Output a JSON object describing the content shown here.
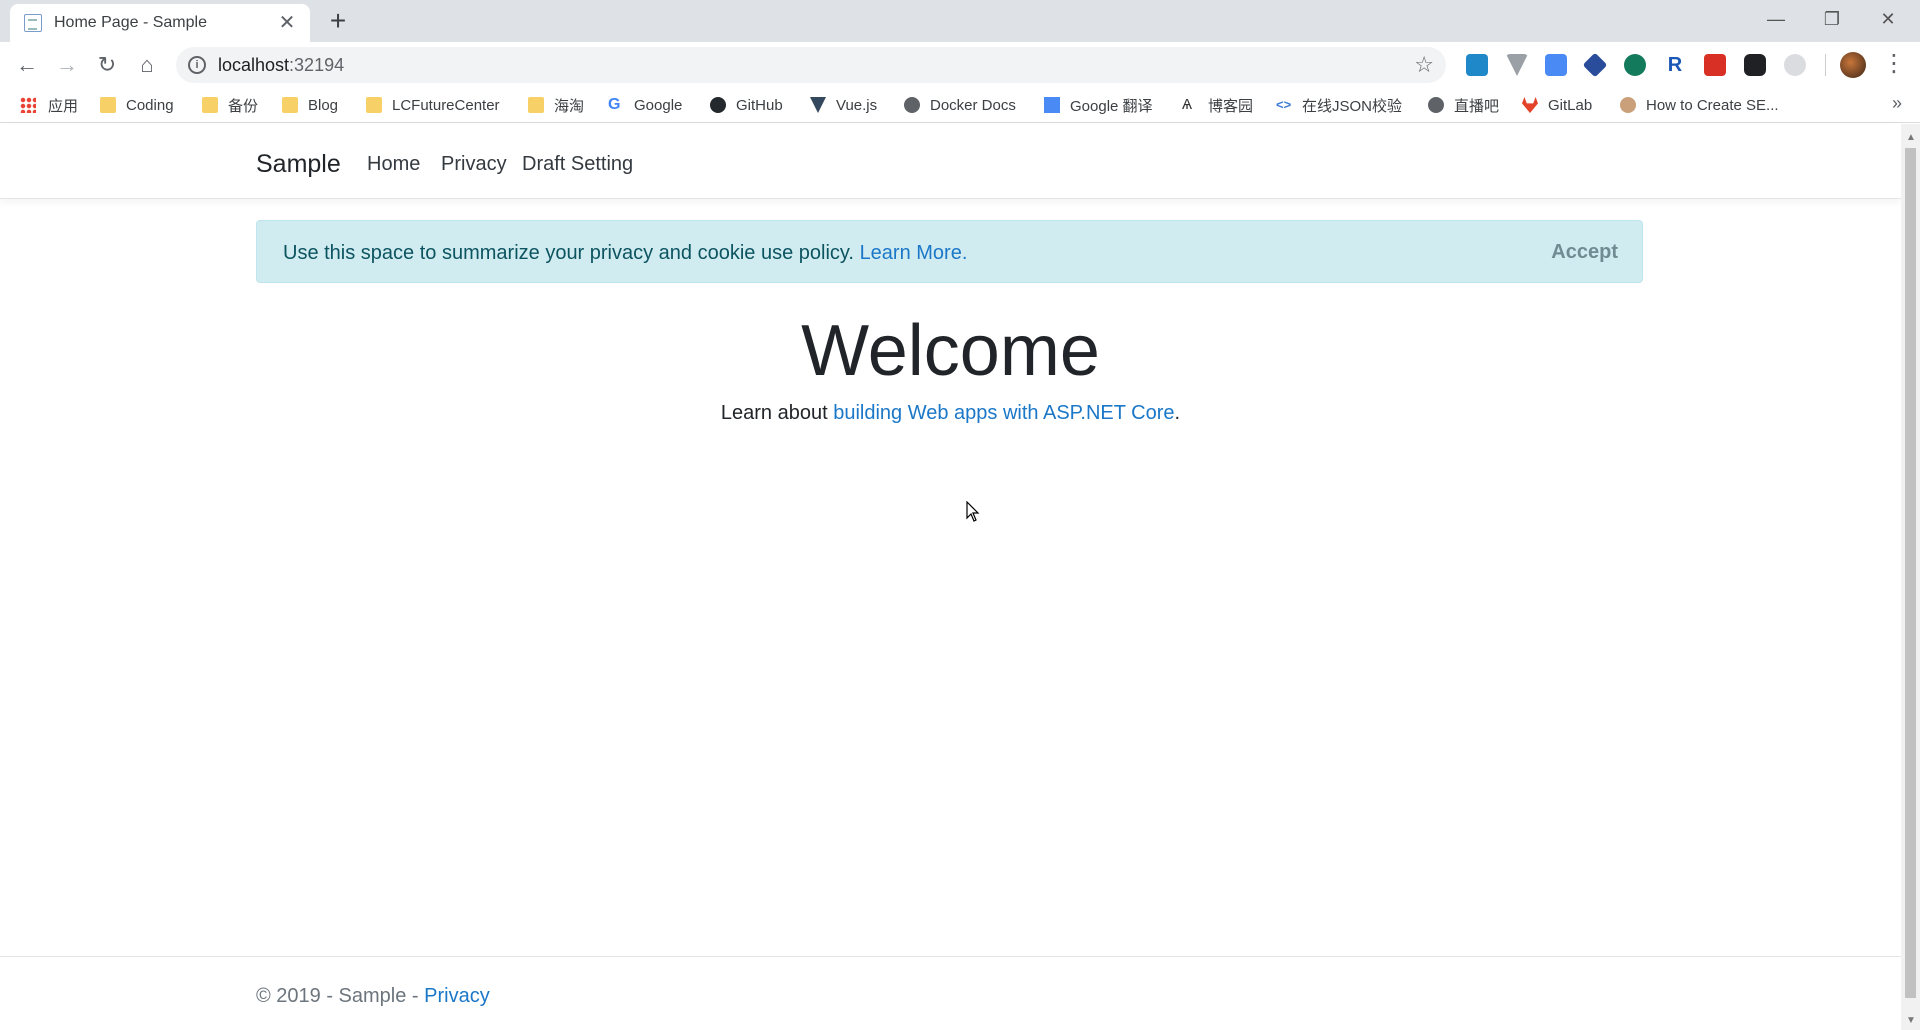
{
  "browser": {
    "tab_title": "Home Page - Sample",
    "tab_close": "✕",
    "new_tab": "+",
    "window_controls": {
      "minimize": "—",
      "restore": "❐",
      "close": "✕"
    },
    "address": {
      "host": "localhost",
      "port": ":32194"
    },
    "bookmarks": [
      {
        "label": "应用",
        "icon": "apps-icon"
      },
      {
        "label": "Coding",
        "icon": "folder-icon"
      },
      {
        "label": "备份",
        "icon": "folder-icon"
      },
      {
        "label": "Blog",
        "icon": "folder-icon"
      },
      {
        "label": "LCFutureCenter",
        "icon": "folder-icon"
      },
      {
        "label": "海淘",
        "icon": "folder-icon"
      },
      {
        "label": "Google",
        "icon": "google-icon"
      },
      {
        "label": "GitHub",
        "icon": "github-icon"
      },
      {
        "label": "Vue.js",
        "icon": "vue-icon"
      },
      {
        "label": "Docker Docs",
        "icon": "docker-icon"
      },
      {
        "label": "Google 翻译",
        "icon": "translate-icon"
      },
      {
        "label": "博客园",
        "icon": "cnblogs-icon"
      },
      {
        "label": "在线JSON校验",
        "icon": "json-icon"
      },
      {
        "label": "直播吧",
        "icon": "zhibo-icon"
      },
      {
        "label": "GitLab",
        "icon": "gitlab-icon"
      },
      {
        "label": "How to Create SE...",
        "icon": "avatar-icon"
      }
    ],
    "bookmarks_more": "»"
  },
  "site": {
    "brand": "Sample",
    "nav": [
      "Home",
      "Privacy",
      "Draft Setting"
    ],
    "cookie": {
      "text": "Use this space to summarize your privacy and cookie use policy.",
      "link": "Learn More",
      "link_suffix": ".",
      "accept": "Accept"
    },
    "welcome": "Welcome",
    "learn_prefix": "Learn about",
    "learn_link": "building Web apps with ASP.NET Core",
    "learn_suffix": ".",
    "footer": {
      "text": "© 2019 - Sample -",
      "link": "Privacy"
    }
  },
  "colors": {
    "link": "#1b77c7",
    "alert_bg": "#d1ecf1",
    "alert_text": "#0c5460",
    "chrome_bg": "#dee1e6"
  }
}
